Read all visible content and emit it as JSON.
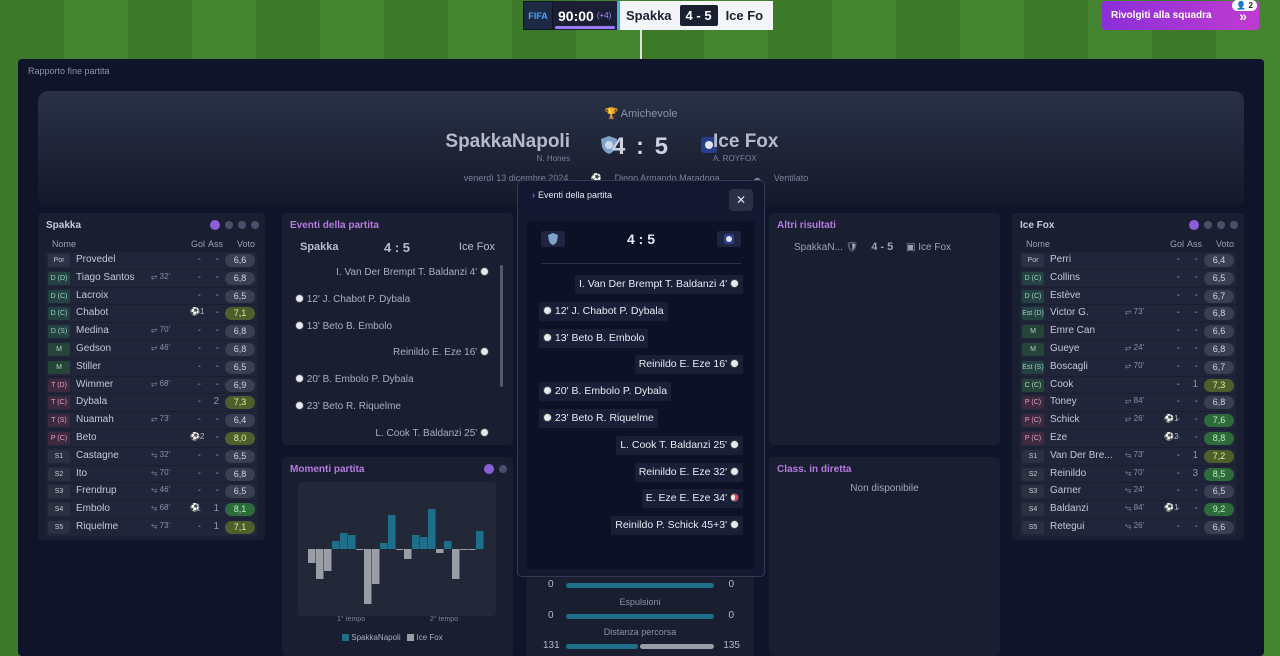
{
  "top": {
    "fifa_logo": "FIFA",
    "time": "90:00",
    "added": "(+4)",
    "home": "Spakka",
    "score": "4 - 5",
    "away": "Ice Fo",
    "return_label": "Rivolgiti alla squadra",
    "return_badge": "2"
  },
  "modal": {
    "title": "Rapporto fine partita"
  },
  "match": {
    "competition": "Amichevole",
    "home_team": "SpakkaNapoli",
    "home_manager": "N. Hones",
    "score": "4 : 5",
    "away_team": "Ice Fox",
    "away_manager": "A. ROYFOX",
    "date": "venerdì 13 dicembre 2024",
    "stadium": "Diego Armando Maradona",
    "weather": "Ventilato"
  },
  "home_lineup": {
    "title": "Spakka",
    "headers": {
      "name": "Nome",
      "gol": "Gol",
      "ass": "Ass",
      "voto": "Voto"
    },
    "rows": [
      {
        "pos": "Por",
        "name": "Provedel",
        "sub": "",
        "ev": "",
        "gol": "-",
        "ass": "-",
        "voto": "6,6",
        "cls": "",
        "pcls": ""
      },
      {
        "pos": "D (D)",
        "name": "Tiago Santos",
        "sub": "⥂ 32'",
        "ev": "",
        "gol": "-",
        "ass": "-",
        "voto": "6,8",
        "cls": "",
        "pcls": "p-def"
      },
      {
        "pos": "D (C)",
        "name": "Lacroix",
        "sub": "",
        "ev": "",
        "gol": "-",
        "ass": "-",
        "voto": "6,5",
        "cls": "",
        "pcls": "p-def"
      },
      {
        "pos": "D (C)",
        "name": "Chabot",
        "sub": "",
        "ev": "⚽1",
        "gol": "-",
        "ass": "-",
        "voto": "7,1",
        "cls": "v-mid",
        "pcls": "p-def"
      },
      {
        "pos": "D (S)",
        "name": "Medina",
        "sub": "⥂ 70'",
        "ev": "",
        "gol": "-",
        "ass": "-",
        "voto": "6,8",
        "cls": "",
        "pcls": "p-def"
      },
      {
        "pos": "M",
        "name": "Gedson",
        "sub": "⥂ 46'",
        "ev": "",
        "gol": "-",
        "ass": "-",
        "voto": "6,8",
        "cls": "",
        "pcls": "p-mid"
      },
      {
        "pos": "M",
        "name": "Stiller",
        "sub": "",
        "ev": "",
        "gol": "-",
        "ass": "-",
        "voto": "6,5",
        "cls": "",
        "pcls": "p-mid"
      },
      {
        "pos": "T (D)",
        "name": "Wimmer",
        "sub": "⥂ 68'",
        "ev": "",
        "gol": "-",
        "ass": "-",
        "voto": "6,9",
        "cls": "",
        "pcls": "p-att"
      },
      {
        "pos": "T (C)",
        "name": "Dybala",
        "sub": "",
        "ev": "",
        "gol": "-",
        "ass": "2",
        "voto": "7,3",
        "cls": "v-mid",
        "pcls": "p-att"
      },
      {
        "pos": "T (S)",
        "name": "Nuamah",
        "sub": "⥂ 73'",
        "ev": "",
        "gol": "-",
        "ass": "-",
        "voto": "6,4",
        "cls": "",
        "pcls": "p-att"
      },
      {
        "pos": "P (C)",
        "name": "Beto",
        "sub": "",
        "ev": "⚽2",
        "gol": "-",
        "ass": "-",
        "voto": "8,0",
        "cls": "v-mid",
        "pcls": "p-att"
      },
      {
        "pos": "S1",
        "name": "Castagne",
        "sub": "⥃ 32'",
        "ev": "",
        "gol": "-",
        "ass": "-",
        "voto": "6,5",
        "cls": "",
        "pcls": "p-sub"
      },
      {
        "pos": "S2",
        "name": "Ito",
        "sub": "⥃ 70'",
        "ev": "",
        "gol": "-",
        "ass": "-",
        "voto": "6,8",
        "cls": "",
        "pcls": "p-sub"
      },
      {
        "pos": "S3",
        "name": "Frendrup",
        "sub": "⥃ 46'",
        "ev": "",
        "gol": "-",
        "ass": "-",
        "voto": "6,5",
        "cls": "",
        "pcls": "p-sub"
      },
      {
        "pos": "S4",
        "name": "Embolo",
        "sub": "⥃ 68'",
        "ev": "⚽",
        "gol": "1",
        "ass": "1",
        "voto": "8,1",
        "cls": "v-good",
        "pcls": "p-sub"
      },
      {
        "pos": "S5",
        "name": "Riquelme",
        "sub": "⥃ 73'",
        "ev": "",
        "gol": "-",
        "ass": "1",
        "voto": "7,1",
        "cls": "v-mid",
        "pcls": "p-sub"
      }
    ]
  },
  "away_lineup": {
    "title": "Ice Fox",
    "headers": {
      "name": "Nome",
      "gol": "Gol",
      "ass": "Ass",
      "voto": "Voto"
    },
    "rows": [
      {
        "pos": "Por",
        "name": "Perri",
        "sub": "",
        "ev": "",
        "gol": "-",
        "ass": "-",
        "voto": "6,4",
        "cls": "",
        "pcls": ""
      },
      {
        "pos": "D (C)",
        "name": "Collins",
        "sub": "",
        "ev": "",
        "gol": "-",
        "ass": "-",
        "voto": "6,5",
        "cls": "",
        "pcls": "p-def"
      },
      {
        "pos": "D (C)",
        "name": "Estève",
        "sub": "",
        "ev": "",
        "gol": "-",
        "ass": "-",
        "voto": "6,7",
        "cls": "",
        "pcls": "p-def"
      },
      {
        "pos": "Est (D)",
        "name": "Victor G.",
        "sub": "⥂ 73'",
        "ev": "",
        "gol": "-",
        "ass": "-",
        "voto": "6,8",
        "cls": "",
        "pcls": "p-def"
      },
      {
        "pos": "M",
        "name": "Emre Can",
        "sub": "",
        "ev": "",
        "gol": "-",
        "ass": "-",
        "voto": "6,6",
        "cls": "",
        "pcls": "p-mid"
      },
      {
        "pos": "M",
        "name": "Gueye",
        "sub": "⥂ 24'",
        "ev": "",
        "gol": "-",
        "ass": "-",
        "voto": "6,8",
        "cls": "",
        "pcls": "p-mid"
      },
      {
        "pos": "Est (S)",
        "name": "Boscagli",
        "sub": "⥂ 70'",
        "ev": "",
        "gol": "-",
        "ass": "-",
        "voto": "6,7",
        "cls": "",
        "pcls": "p-def"
      },
      {
        "pos": "C (C)",
        "name": "Cook",
        "sub": "",
        "ev": "",
        "gol": "-",
        "ass": "1",
        "voto": "7,3",
        "cls": "v-mid",
        "pcls": "p-mid"
      },
      {
        "pos": "P (C)",
        "name": "Toney",
        "sub": "⥂ 84'",
        "ev": "",
        "gol": "-",
        "ass": "-",
        "voto": "6,8",
        "cls": "",
        "pcls": "p-att"
      },
      {
        "pos": "P (C)",
        "name": "Schick",
        "sub": "⥂ 26'",
        "ev": "⚽1",
        "gol": "-",
        "ass": "-",
        "voto": "7,6",
        "cls": "v-good",
        "pcls": "p-att"
      },
      {
        "pos": "P (C)",
        "name": "Eze",
        "sub": "",
        "ev": "⚽2",
        "gol": "-",
        "ass": "-",
        "voto": "8,8",
        "cls": "v-good",
        "pcls": "p-att"
      },
      {
        "pos": "S1",
        "name": "Van Der Bre...",
        "sub": "⥃ 73'",
        "ev": "",
        "gol": "-",
        "ass": "1",
        "voto": "7,2",
        "cls": "v-mid",
        "pcls": "p-sub"
      },
      {
        "pos": "S2",
        "name": "Reinildo",
        "sub": "⥃ 70'",
        "ev": "",
        "gol": "-",
        "ass": "3",
        "voto": "8,5",
        "cls": "v-good",
        "pcls": "p-sub"
      },
      {
        "pos": "S3",
        "name": "Garner",
        "sub": "⥃ 24'",
        "ev": "",
        "gol": "-",
        "ass": "-",
        "voto": "6,5",
        "cls": "",
        "pcls": "p-sub"
      },
      {
        "pos": "S4",
        "name": "Baldanzi",
        "sub": "⥃ 84'",
        "ev": "⚽1",
        "gol": "-",
        "ass": "-",
        "voto": "9,2",
        "cls": "v-good",
        "pcls": "p-sub"
      },
      {
        "pos": "S5",
        "name": "Retegui",
        "sub": "⥃ 26'",
        "ev": "",
        "gol": "-",
        "ass": "-",
        "voto": "6,6",
        "cls": "",
        "pcls": "p-sub"
      }
    ]
  },
  "events_panel": {
    "title": "Eventi della partita",
    "home": "Spakka",
    "score": "4 : 5",
    "away": "Ice Fox",
    "items": [
      {
        "text": "I. Van Der Brempt  T. Baldanzi 4'",
        "side": "r"
      },
      {
        "text": "12'  J. Chabot  P. Dybala",
        "side": "l"
      },
      {
        "text": "13'  Beto  B. Embolo",
        "side": "l"
      },
      {
        "text": "Reinildo  E. Eze 16'",
        "side": "r"
      },
      {
        "text": "20'  B. Embolo  P. Dybala",
        "side": "l"
      },
      {
        "text": "23'  Beto  R. Riquelme",
        "side": "l"
      },
      {
        "text": "L. Cook  T. Baldanzi 25'",
        "side": "r"
      }
    ]
  },
  "altri": {
    "title": "Altri risultati",
    "home": "SpakkaN...",
    "score": "4 - 5",
    "away": "Ice Fox"
  },
  "momenti": {
    "title": "Momenti partita",
    "label_1": "1° tempo",
    "label_2": "2° tempo",
    "legend_home": "SpakkaNapoli",
    "legend_away": "Ice Fox"
  },
  "class": {
    "title": "Class. in diretta",
    "text": "Non disponibile"
  },
  "stats": {
    "row1_home": "0",
    "row1_away": "0",
    "label_esp": "Espulsioni",
    "row2_home": "0",
    "row2_away": "0",
    "label_dist": "Distanza percorsa",
    "row3_home": "131",
    "row3_away": "135"
  },
  "overlay": {
    "title": "Eventi della partita",
    "score": "4 : 5",
    "close": "✕",
    "events": [
      {
        "text": "I. Van Der Brempt  T. Baldanzi 4'",
        "side": "r",
        "icon": "ball"
      },
      {
        "text": "12'  J. Chabot  P. Dybala",
        "side": "l",
        "icon": "ball"
      },
      {
        "text": "13'  Beto  B. Embolo",
        "side": "l",
        "icon": "ball"
      },
      {
        "text": "Reinildo  E. Eze 16'",
        "side": "r",
        "icon": "ball"
      },
      {
        "text": "20'  B. Embolo  P. Dybala",
        "side": "l",
        "icon": "ball"
      },
      {
        "text": "23'  Beto  R. Riquelme",
        "side": "l",
        "icon": "ball"
      },
      {
        "text": "L. Cook  T. Baldanzi 25'",
        "side": "r",
        "icon": "ball"
      },
      {
        "text": "Reinildo  E. Eze 32'",
        "side": "r",
        "icon": "ball"
      },
      {
        "text": "E. Eze  E. Eze 34'",
        "side": "r",
        "icon": "ball-red"
      },
      {
        "text": "Reinildo  P. Schick 45+3'",
        "side": "r",
        "icon": "ball"
      }
    ]
  },
  "colors": {
    "home_bar": "#1f6f8a",
    "away_bar": "#9a9ca6",
    "accent": "#8b2fd9"
  }
}
